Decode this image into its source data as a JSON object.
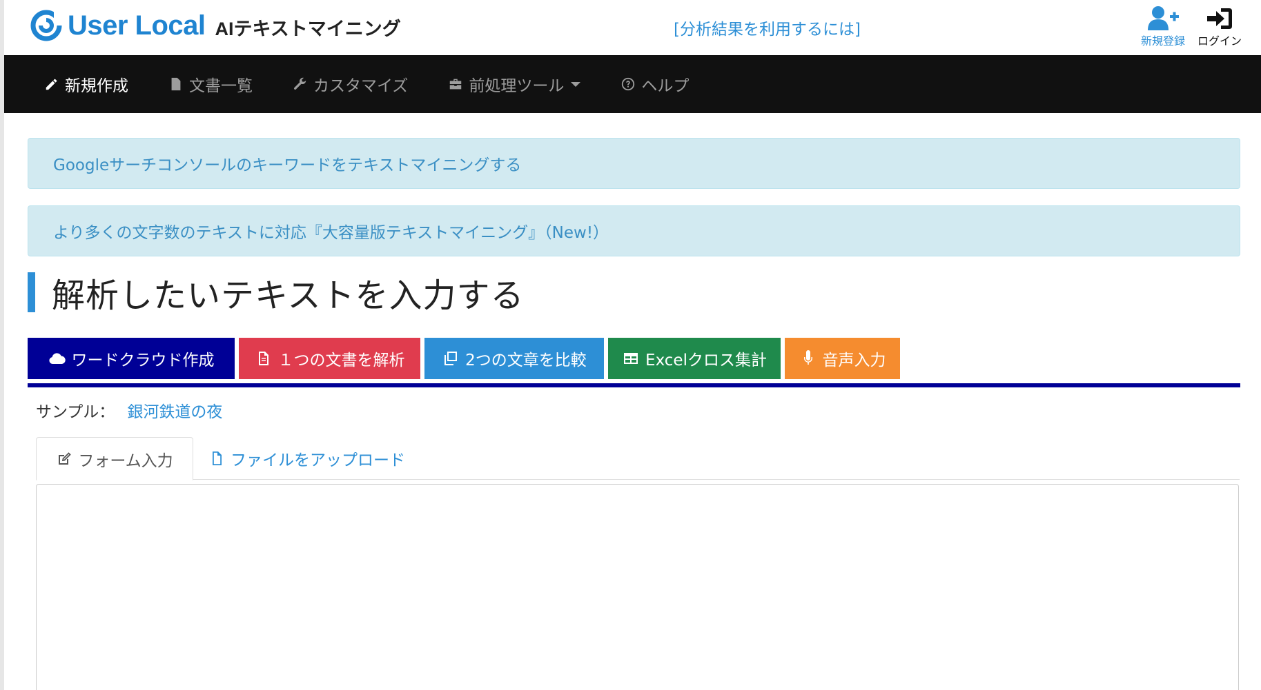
{
  "header": {
    "logo_text": "User Local",
    "logo_subtitle": "AIテキストマイニング",
    "result_link": "[分析結果を利用するには]",
    "register_label": "新規登録",
    "login_label": "ログイン",
    "brand_color": "#1f84d1"
  },
  "nav": {
    "items": [
      {
        "label": "新規作成",
        "icon": "pencil-icon",
        "active": true
      },
      {
        "label": "文書一覧",
        "icon": "document-icon",
        "active": false
      },
      {
        "label": "カスタマイズ",
        "icon": "wrench-icon",
        "active": false
      },
      {
        "label": "前処理ツール",
        "icon": "toolbox-icon",
        "active": false,
        "dropdown": true
      },
      {
        "label": "ヘルプ",
        "icon": "question-circle-icon",
        "active": false
      }
    ]
  },
  "alerts": [
    "Googleサーチコンソールのキーワードをテキストマイニングする",
    "より多くの文字数のテキストに対応『大容量版テキストマイニング』（New!）"
  ],
  "page_title": "解析したいテキストを入力する",
  "tool_tabs": [
    {
      "label": "ワードクラウド作成",
      "icon": "cloud-icon",
      "color": "#000096"
    },
    {
      "label": "１つの文書を解析",
      "icon": "document-icon",
      "color": "#e03c4e"
    },
    {
      "label": "2つの文章を比較",
      "icon": "copy-icon",
      "color": "#2d8fd6"
    },
    {
      "label": "Excelクロス集計",
      "icon": "table-icon",
      "color": "#1f8a4c"
    },
    {
      "label": "音声入力",
      "icon": "microphone-icon",
      "color": "#f58c2f"
    }
  ],
  "sample": {
    "label": "サンプル：",
    "link": "銀河鉄道の夜"
  },
  "form_tabs": [
    {
      "label": "フォーム入力",
      "icon": "edit-icon",
      "active": true
    },
    {
      "label": "ファイルをアップロード",
      "icon": "file-icon",
      "active": false
    }
  ],
  "textarea": {
    "value": ""
  }
}
